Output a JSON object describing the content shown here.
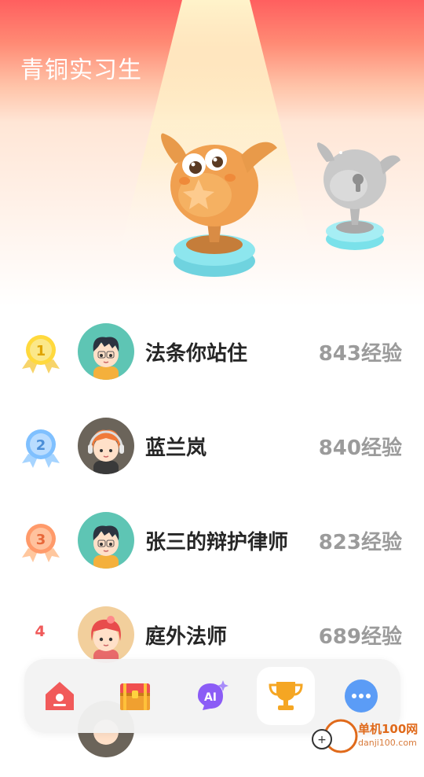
{
  "header": {
    "rank_title": "青铜实习生"
  },
  "colors": {
    "accent_red": "#ff5f5f",
    "trophy_bronze": "#f0a050",
    "xp_gray": "#9b9b9b",
    "rank_red": "#f05a5a"
  },
  "ranking": [
    {
      "rank": "1",
      "medal": "gold-medal-icon",
      "name": "法条你站住",
      "xp": "843经验"
    },
    {
      "rank": "2",
      "medal": "silver-medal-icon",
      "name": "蓝兰岚",
      "xp": "840经验"
    },
    {
      "rank": "3",
      "medal": "bronze-medal-icon",
      "name": "张三的辩护律师",
      "xp": "823经验"
    },
    {
      "rank": "4",
      "name": "庭外法师",
      "xp": "689经验"
    }
  ],
  "tabs": [
    {
      "icon": "home-icon"
    },
    {
      "icon": "treasure-chest-icon"
    },
    {
      "icon": "ai-icon",
      "label": "AI"
    },
    {
      "icon": "trophy-icon",
      "active": true
    },
    {
      "icon": "more-icon"
    }
  ],
  "watermark": {
    "line1": "单机100网",
    "line2": "danji100.com"
  }
}
